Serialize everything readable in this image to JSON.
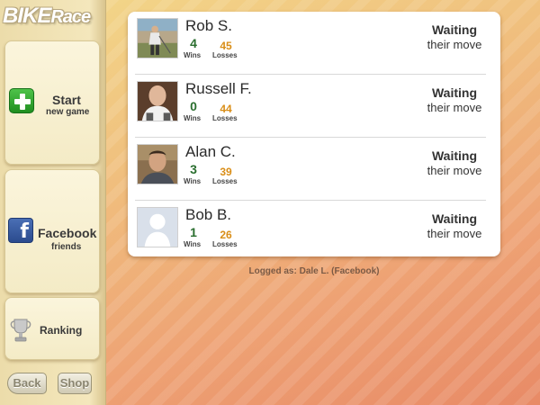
{
  "app": {
    "logo_part1": "BIKE",
    "logo_part2": "Race"
  },
  "sidebar": {
    "start": {
      "label": "Start",
      "sub": "new game",
      "icon": "plus-icon"
    },
    "facebook": {
      "label": "Facebook",
      "sub": "friends",
      "icon": "facebook-icon"
    },
    "ranking": {
      "label": "Ranking",
      "icon": "trophy-icon"
    },
    "back_label": "Back",
    "shop_label": "Shop"
  },
  "games": [
    {
      "name": "Rob S.",
      "wins": "4",
      "losses": "45",
      "wins_label": "Wins",
      "losses_label": "Losses",
      "status": "Waiting",
      "status_sub": "their move",
      "avatar": "photo-golf"
    },
    {
      "name": "Russell F.",
      "wins": "0",
      "losses": "44",
      "wins_label": "Wins",
      "losses_label": "Losses",
      "status": "Waiting",
      "status_sub": "their move",
      "avatar": "photo-man"
    },
    {
      "name": "Alan C.",
      "wins": "3",
      "losses": "39",
      "wins_label": "Wins",
      "losses_label": "Losses",
      "status": "Waiting",
      "status_sub": "their move",
      "avatar": "photo-man-outdoor"
    },
    {
      "name": "Bob B.",
      "wins": "1",
      "losses": "26",
      "wins_label": "Wins",
      "losses_label": "Losses",
      "status": "Waiting",
      "status_sub": "their move",
      "avatar": "default-avatar"
    }
  ],
  "footer": {
    "logged_as": "Logged as: Dale L. (Facebook)"
  },
  "colors": {
    "wins": "#2a6e2f",
    "losses": "#d98e18",
    "facebook": "#3b5998",
    "accent_green": "#2e9e2c"
  }
}
